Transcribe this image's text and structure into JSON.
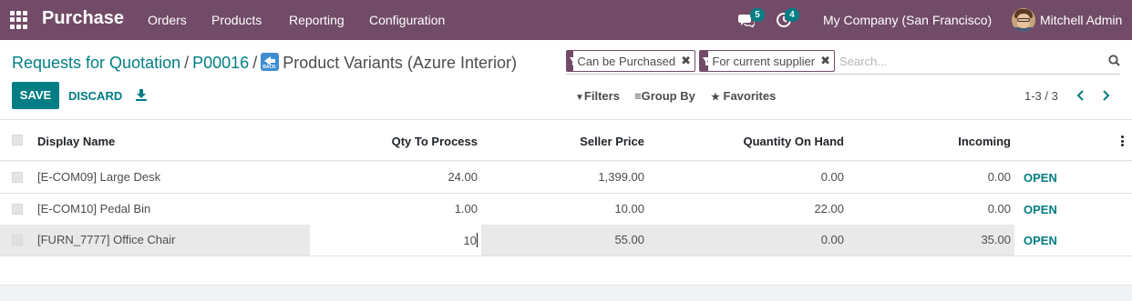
{
  "navbar": {
    "app_name": "Purchase",
    "menu": [
      "Orders",
      "Products",
      "Reporting",
      "Configuration"
    ],
    "messages_count": "5",
    "activities_count": "4",
    "company": "My Company (San Francisco)",
    "user": "Mitchell Admin",
    "background_color": "#714b67"
  },
  "breadcrumb": {
    "items": [
      "Requests for Quotation",
      "P00016"
    ],
    "current": "Product Variants (Azure Interior)"
  },
  "search": {
    "facets": [
      "Can be Purchased",
      "For current supplier"
    ],
    "placeholder": "Search...",
    "filters_label": "Filters",
    "group_by_label": "Group By",
    "favorites_label": "Favorites"
  },
  "buttons": {
    "save": "SAVE",
    "discard": "DISCARD"
  },
  "pager": {
    "value": "1-3 / 3"
  },
  "table": {
    "columns": [
      "Display Name",
      "Qty To Process",
      "Seller Price",
      "Quantity On Hand",
      "Incoming"
    ],
    "rows": [
      {
        "name": "[E-COM09] Large Desk",
        "qty": "24.00",
        "price": "1,399.00",
        "on_hand": "0.00",
        "incoming": "0.00",
        "action": "OPEN"
      },
      {
        "name": "[E-COM10] Pedal Bin",
        "qty": "1.00",
        "price": "10.00",
        "on_hand": "22.00",
        "incoming": "0.00",
        "action": "OPEN"
      },
      {
        "name": "[FURN_7777] Office Chair",
        "qty": "10",
        "price": "55.00",
        "on_hand": "0.00",
        "incoming": "35.00",
        "action": "OPEN"
      }
    ]
  },
  "colors": {
    "accent": "#017e84",
    "brand": "#714b67"
  }
}
